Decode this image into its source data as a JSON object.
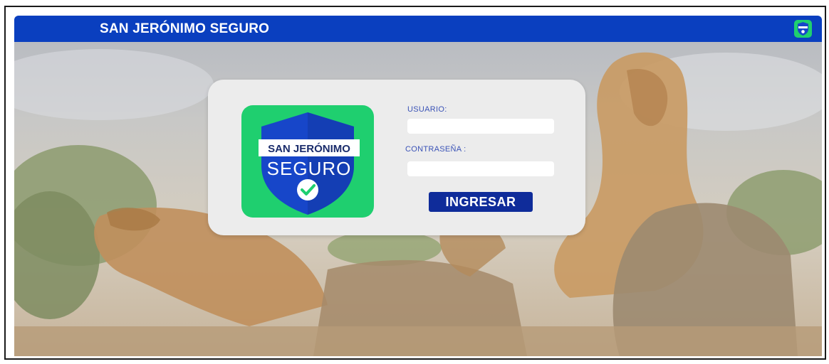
{
  "header": {
    "title": "SAN JERÓNIMO SEGURO"
  },
  "logo": {
    "line1": "SAN JERÓNIMO",
    "line2": "SEGURO",
    "icon": "shield-check-icon"
  },
  "login": {
    "user_label": "USUARIO:",
    "user_value": "",
    "password_label": "CONTRASEÑA :",
    "password_value": "",
    "submit_label": "INGRESAR"
  },
  "colors": {
    "header_bg": "#0a3fbf",
    "button_bg": "#0f2c9a",
    "label_text": "#3b53b7",
    "logo_green": "#1fcf6f",
    "logo_blue": "#1746c9"
  }
}
